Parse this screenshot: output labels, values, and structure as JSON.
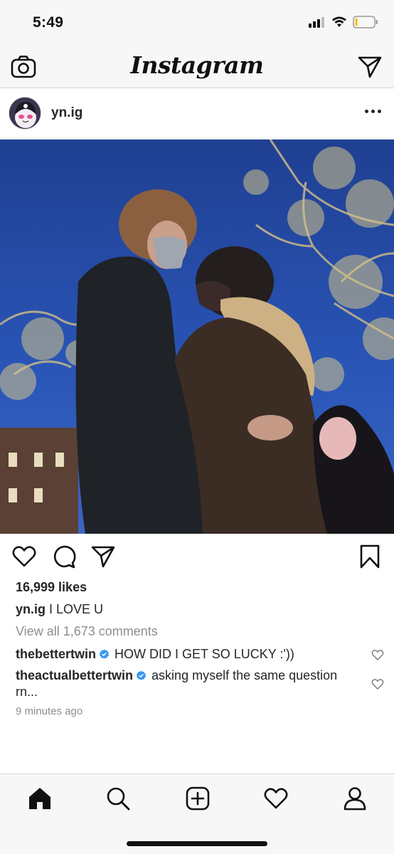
{
  "status_bar": {
    "time": "5:49"
  },
  "nav": {
    "logo": "Instagram",
    "camera_icon": "camera-icon",
    "direct_icon": "paper-plane-icon"
  },
  "post": {
    "username": "yn.ig",
    "likes": "16,999 likes",
    "caption_user": "yn.ig",
    "caption_text": "I LOVE U",
    "view_all": "View all 1,673 comments",
    "comments": [
      {
        "user": "thebettertwin",
        "text": "HOW DID I GET SO LUCKY :'))"
      },
      {
        "user": "theactualbettertwin",
        "text": "asking myself the same question rn..."
      }
    ],
    "timestamp": "9 minutes ago"
  },
  "colors": {
    "text": "#262626",
    "muted": "#8e8e8e",
    "verified": "#3897f0",
    "bar_bg": "#f7f7f7"
  },
  "tabs": [
    "home-icon",
    "search-icon",
    "add-post-icon",
    "heart-icon",
    "profile-icon"
  ]
}
